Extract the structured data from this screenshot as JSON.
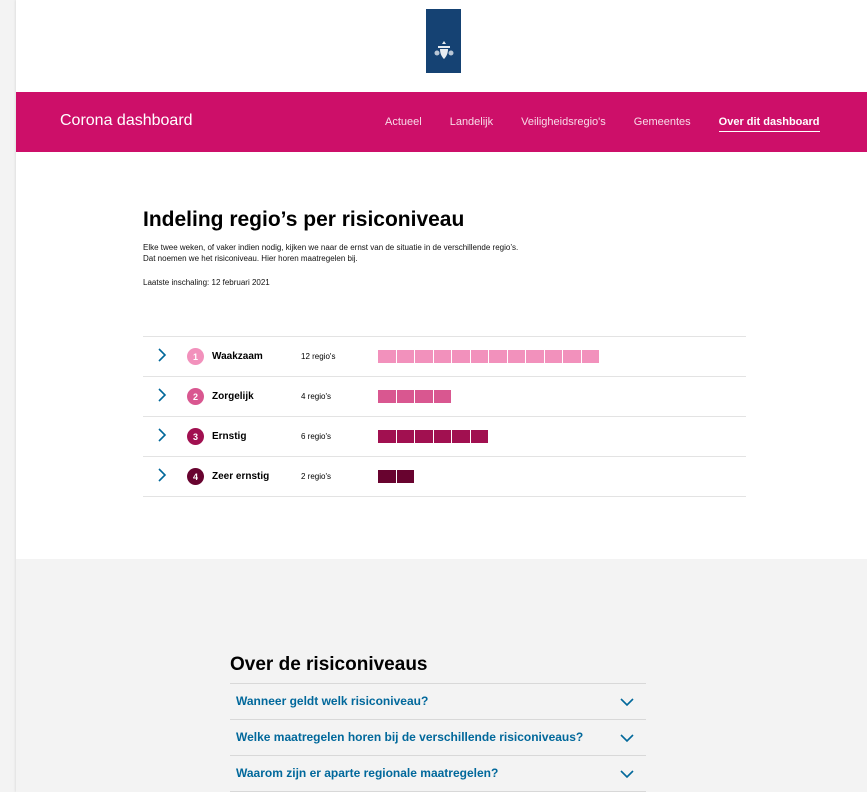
{
  "header": {
    "logo_icon": "crest-icon"
  },
  "nav": {
    "brand": "Corona dashboard",
    "links": [
      "Actueel",
      "Landelijk",
      "Veiligheidsregio's",
      "Gemeentes"
    ],
    "active_link": "Over dit dashboard"
  },
  "main": {
    "title": "Indeling regio’s per risiconiveau",
    "intro": "Elke twee weken, of vaker indien nodig, kijken we naar de ernst van de situatie in de verschillende regio’s. Dat noemen we het risiconiveau. Hier horen maatregelen bij.",
    "last_update": "Laatste inschaling: 12 februari 2021"
  },
  "levels": [
    {
      "number": "1",
      "name": "Waakzaam",
      "count_label": "12 regio's",
      "regions": 12,
      "color": "#f291bc"
    },
    {
      "number": "2",
      "name": "Zorgelijk",
      "count_label": "4 regio's",
      "regions": 4,
      "color": "#d95790"
    },
    {
      "number": "3",
      "name": "Ernstig",
      "count_label": "6 regio's",
      "regions": 6,
      "color": "#a11050"
    },
    {
      "number": "4",
      "name": "Zeer ernstig",
      "count_label": "2 regio's",
      "regions": 2,
      "color": "#68032f"
    }
  ],
  "faq": {
    "title": "Over de risiconiveaus",
    "items": [
      "Wanneer geldt welk risiconiveau?",
      "Welke maatregelen horen bij de verschillende risiconiveaus?",
      "Waarom zijn er aparte regionale maatregelen?"
    ]
  },
  "colors": {
    "brand": "#cd0f69",
    "link": "#01689b",
    "logo_bg": "#154273"
  }
}
